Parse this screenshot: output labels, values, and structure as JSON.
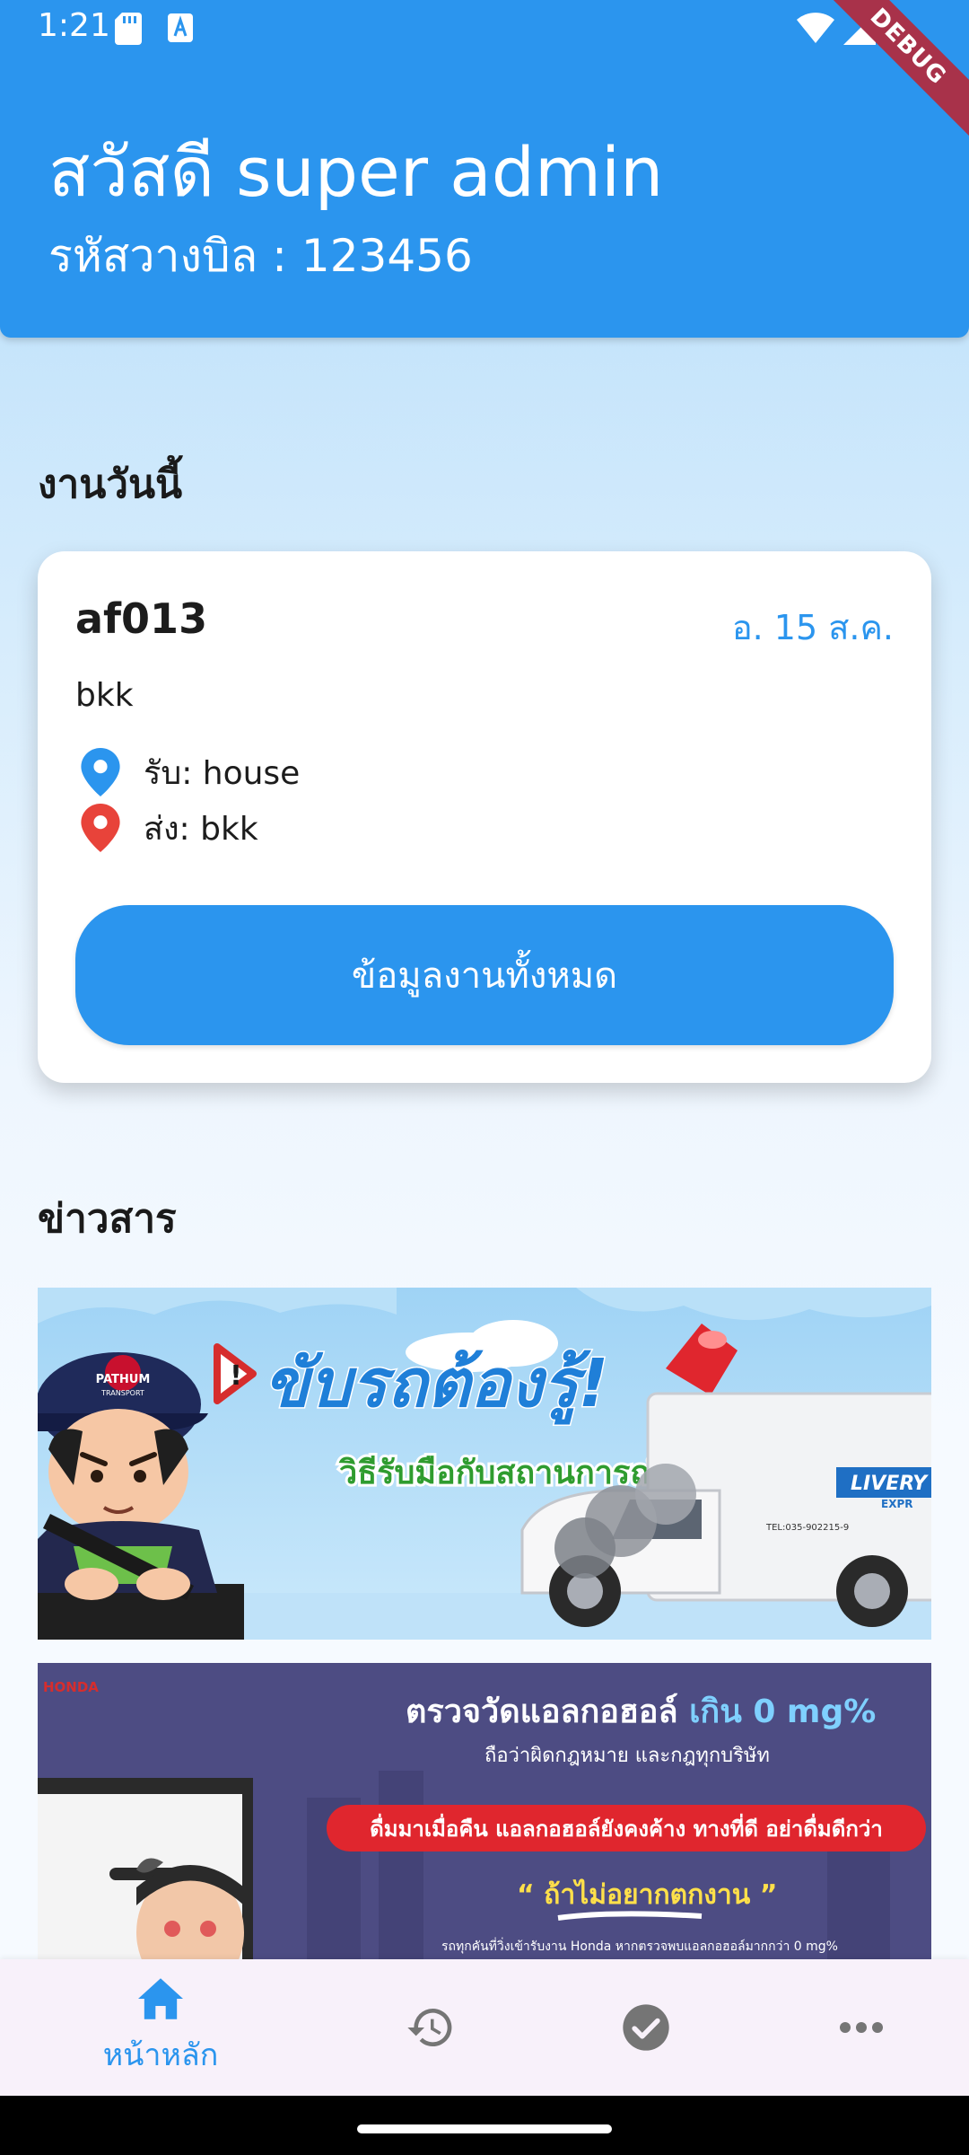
{
  "status_bar": {
    "time": "1:21",
    "debug_label": "DEBUG"
  },
  "header": {
    "greeting": "สวัสดี  super admin",
    "billing_code": "รหัสวางบิล : 123456"
  },
  "today": {
    "section_title": "งานวันนี้",
    "job": {
      "id": "af013",
      "date": "อ. 15 ส.ค.",
      "destination": "bkk",
      "pickup": "รับ: house",
      "dropoff": "ส่ง: bkk"
    },
    "all_jobs_button": "ข้อมูลงานทั้งหมด"
  },
  "news": {
    "section_title": "ข่าวสาร",
    "banners": [
      {
        "headline": "ขับรถต้องรู้!",
        "subheadline": "วิธีรับมือกับสถานการณ์ฉุกเฉิน",
        "cap_brand": "PATHUM",
        "cap_brand_sub": "TRANSPORT",
        "truck_text": "LIVERY",
        "truck_text_sub": "EXPR",
        "truck_phone": "TEL:035-902215-9"
      },
      {
        "logo_text": "HONDA",
        "headline_part": "ตรวจวัดแอลกอฮอล์ ",
        "headline_highlight": "เกิน 0 mg%",
        "subline": "ถือว่าผิดกฎหมาย และกฎทุกบริษัท",
        "pill_text": "ดื่มมาเมื่อคืน แอลกอฮอล์ยังคงค้าง ทางที่ดี อย่าดื่มดีกว่า",
        "quote": "“ ถ้าไม่อยากตกงาน ”",
        "footer": "รถทุกคันที่วิ่งเข้ารับงาน Honda หากตรวจพบแอลกอฮอล์มากกว่า 0 mg%"
      }
    ]
  },
  "bottom_nav": {
    "items": [
      {
        "label": "หน้าหลัก",
        "icon": "home-icon",
        "active": true
      },
      {
        "label": "",
        "icon": "history-icon",
        "active": false
      },
      {
        "label": "",
        "icon": "check-circle-icon",
        "active": false
      },
      {
        "label": "",
        "icon": "more-horizontal-icon",
        "active": false
      }
    ]
  },
  "colors": {
    "primary": "#2b95ee",
    "pickup_pin": "#2b95ee",
    "dropoff_pin": "#e8433a",
    "nav_background": "#f8f1fa",
    "inactive_icon": "#757575"
  }
}
